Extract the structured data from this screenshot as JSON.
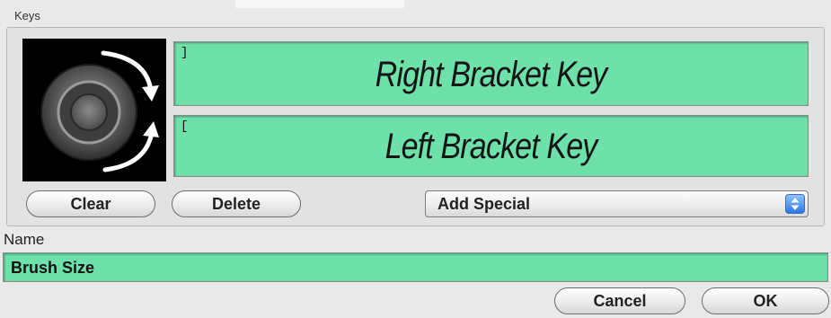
{
  "keys_group": {
    "label": "Keys",
    "right_field": {
      "key_char": "]",
      "key_name": "Right Bracket Key"
    },
    "left_field": {
      "key_char": "[",
      "key_name": "Left Bracket Key"
    }
  },
  "buttons": {
    "clear": "Clear",
    "delete": "Delete",
    "cancel": "Cancel",
    "ok": "OK"
  },
  "add_special": {
    "selected": "Add Special"
  },
  "name_section": {
    "label": "Name",
    "value": "Brush Size"
  },
  "colors": {
    "field_green": "#6ee0a9",
    "window_bg": "#e9e9e9",
    "select_blue": "#2b78e0"
  },
  "icons": {
    "dial": "touch-ring-dial-icon",
    "select": "up-down-arrows-icon"
  }
}
